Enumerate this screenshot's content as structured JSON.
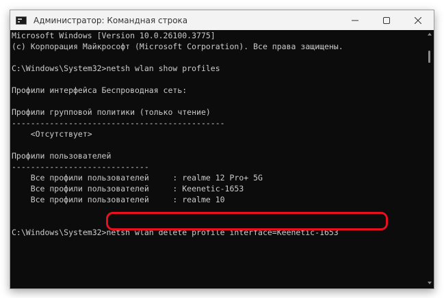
{
  "window": {
    "title": "Администратор: Командная строка",
    "controls": [
      "minimize",
      "maximize",
      "close"
    ]
  },
  "console": {
    "lines": [
      "Microsoft Windows [Version 10.0.26100.3775]",
      "(c) Корпорация Майкрософт (Microsoft Corporation). Все права защищены.",
      "",
      "C:\\Windows\\System32>netsh wlan show profiles",
      "",
      "Профили интерфейса Беспроводная сеть:",
      "",
      "Профили групповой политики (только чтение)",
      "---------------------------------------------",
      "    <Отсутствует>",
      "",
      "Профили пользователей",
      "-----------------------------",
      "    Все профили пользователей     : realme 12 Pro+ 5G",
      "    Все профили пользователей     : Keenetic-1653",
      "    Все профили пользователей     : realme 10",
      "",
      "",
      "C:\\Windows\\System32>netsh wlan delete profile interface=Keenetic-1653"
    ]
  },
  "colors": {
    "terminal_bg": "#0c0c0c",
    "terminal_text": "#cccccc",
    "highlight": "#e8101e"
  }
}
